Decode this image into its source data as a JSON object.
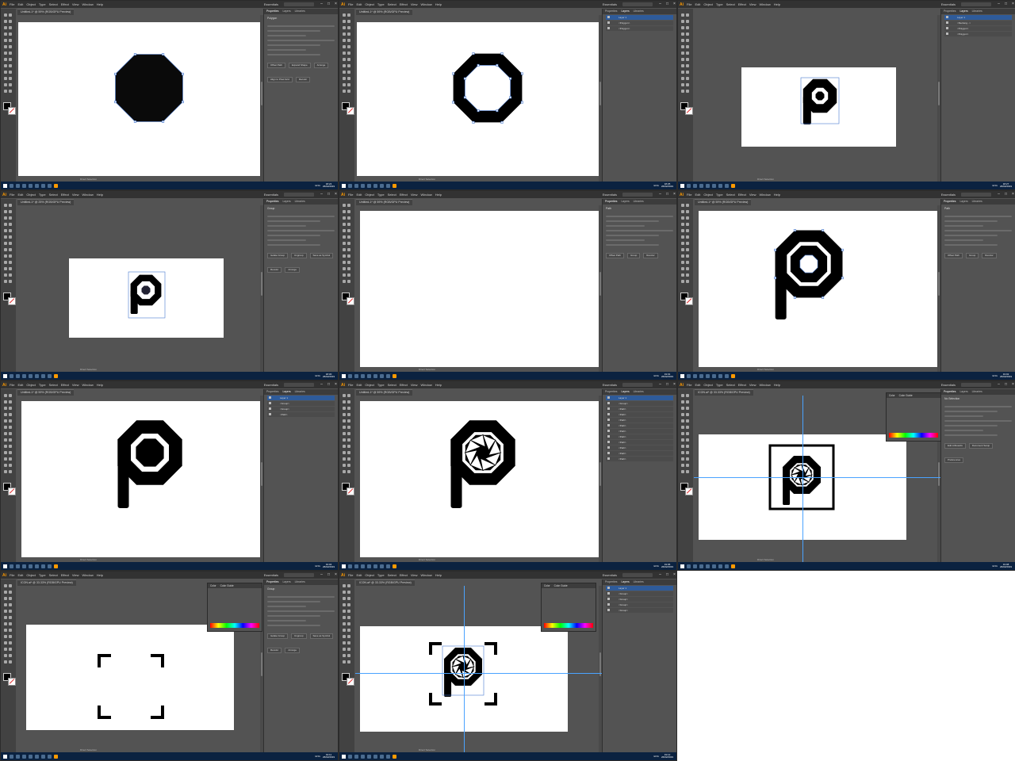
{
  "app": {
    "logo": "Ai",
    "menus": [
      "File",
      "Edit",
      "Object",
      "Type",
      "Select",
      "Effect",
      "View",
      "Window",
      "Help"
    ],
    "workspace": "Essentials"
  },
  "panel_tabs": [
    "Properties",
    "Layers",
    "Libraries"
  ],
  "color_panel_tabs": [
    "Color",
    "Color Guide"
  ],
  "taskbar": {
    "language": "ENG"
  },
  "status_tool": "Direct Selection",
  "colors": {
    "app_bg": "#535353",
    "menubar": "#323232",
    "taskbar": "#0b2240",
    "selection": "#4a7bd0",
    "accent": "#ff9a00"
  },
  "frames": [
    {
      "doc_title": "Untitled-1* @ 59% (RGB/GPU Preview)",
      "panel_title": "Polygon",
      "buttons": [
        "Offset Path",
        "Expand Shape",
        "Arrange",
        "Align to Pixel Grid",
        "Recolor"
      ],
      "time": "18:24",
      "date": "26/02/2019"
    },
    {
      "doc_title": "Untitled-1* @ 59% (RGB/GPU Preview)",
      "panel_title": "",
      "layers": [
        "Layer 1",
        "<Polygon>",
        "<Polygon>"
      ],
      "time": "18:25",
      "date": "26/02/2019"
    },
    {
      "doc_title": "",
      "panel_title": "",
      "layers": [
        "Layer 1",
        "<Rectang...>",
        "<Polygon>",
        "<Polygon>"
      ],
      "time": "18:27",
      "date": "26/02/2019"
    },
    {
      "doc_title": "Untitled-1* @ 25% (RGB/GPU Preview)",
      "panel_title": "Group",
      "buttons": [
        "Isolate Group",
        "Ungroup",
        "Save as Symbol",
        "Recolor",
        "Arrange"
      ],
      "time": "18:30",
      "date": "26/02/2019"
    },
    {
      "doc_title": "Untitled-1* @ 59% (RGB/GPU Preview)",
      "panel_title": "Path",
      "buttons": [
        "Offset Path",
        "Group",
        "Recolor"
      ],
      "time": "19:01",
      "date": "26/02/2019"
    },
    {
      "doc_title": "Untitled-1* @ 59% (RGB/GPU Preview)",
      "panel_title": "Path",
      "buttons": [
        "Offset Path",
        "Group",
        "Recolor"
      ],
      "time": "19:02",
      "date": "26/02/2019"
    },
    {
      "doc_title": "Untitled-1* @ 59% (RGB/GPU Preview)",
      "panel_title": "",
      "layers": [
        "Layer 1",
        "<Group>",
        "<Group>",
        "<Path>"
      ],
      "time": "19:04",
      "date": "26/02/2019"
    },
    {
      "doc_title": "Untitled-1* @ 59% (RGB/GPU Preview)",
      "panel_title": "",
      "layers": [
        "Layer 1",
        "<Group>",
        "<Path>",
        "<Path>",
        "<Path>",
        "<Path>",
        "<Path>",
        "<Path>",
        "<Path>",
        "<Path>",
        "<Path>",
        "<Path>"
      ],
      "time": "19:06",
      "date": "26/02/2019"
    },
    {
      "doc_title": "ICON.ai* @ 33.33% (RGB/GPU Preview)",
      "panel_title": "No Selection",
      "buttons": [
        "Edit Artboards",
        "Document Setup",
        "Preferences"
      ],
      "time": "19:08",
      "date": "26/02/2019"
    },
    {
      "doc_title": "ICON.ai* @ 33.33% (RGB/GPU Preview)",
      "panel_title": "Group",
      "buttons": [
        "Isolate Group",
        "Ungroup",
        "Save as Symbol",
        "Recolor",
        "Arrange"
      ],
      "time": "19:11",
      "date": "26/02/2019"
    },
    {
      "doc_title": "ICON.ai* @ 33.33% (RGB/GPU Preview)",
      "panel_title": "",
      "layers": [
        "Layer 1",
        "<Group>",
        "<Group>",
        "<Group>",
        "<Group>"
      ],
      "time": "19:12",
      "date": "26/02/2019"
    }
  ]
}
